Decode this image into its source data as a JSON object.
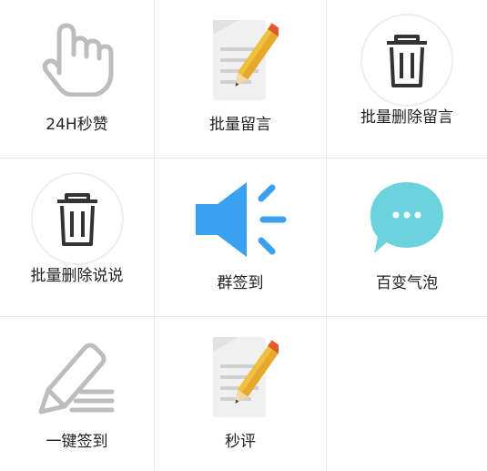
{
  "menu": {
    "items": [
      {
        "label": "24H秒赞",
        "icon": "hand-pointer-icon"
      },
      {
        "label": "批量留言",
        "icon": "notepad-pencil-icon"
      },
      {
        "label": "批量删除留言",
        "icon": "trash-icon"
      },
      {
        "label": "批量删除说说",
        "icon": "trash-icon"
      },
      {
        "label": "群签到",
        "icon": "speaker-icon"
      },
      {
        "label": "百变气泡",
        "icon": "chat-bubble-icon"
      },
      {
        "label": "一键签到",
        "icon": "pencil-edit-icon"
      },
      {
        "label": "秒评",
        "icon": "notepad-pencil-icon"
      }
    ]
  },
  "colors": {
    "speaker": "#3aa0f0",
    "bubble": "#6cd3dc",
    "pencil_body": "#f0c040",
    "pencil_tip": "#e05b2a",
    "notepad": "#f0f0f0",
    "trash_stroke": "#333333",
    "grey_icon": "#bdbdbd"
  }
}
